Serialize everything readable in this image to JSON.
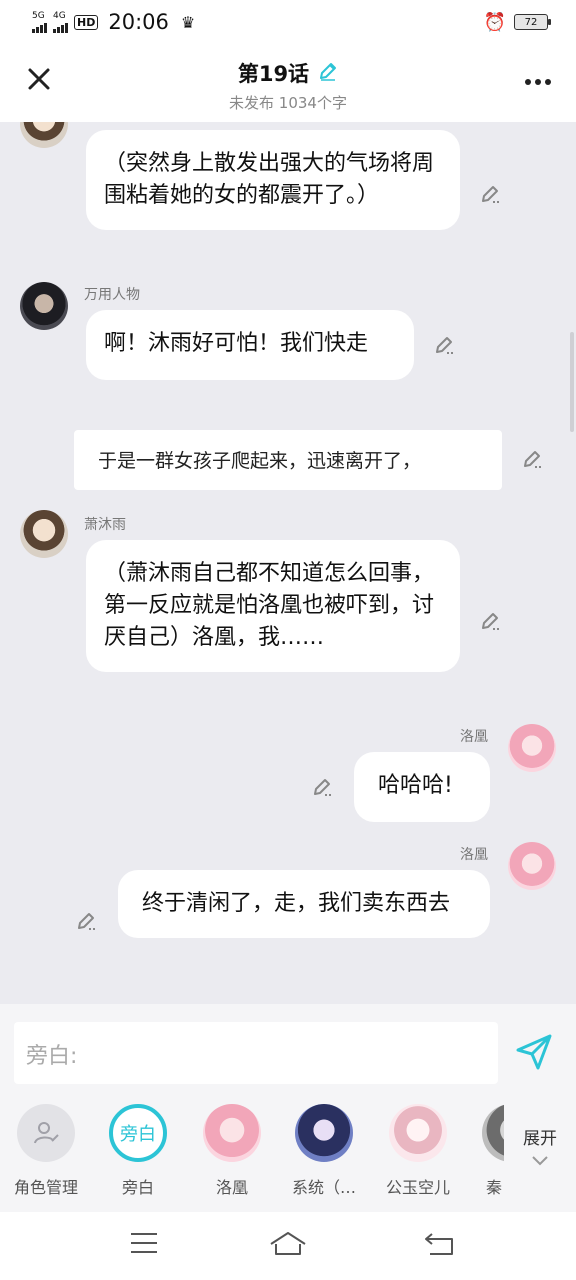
{
  "status_bar": {
    "network1": "5G",
    "network2": "4G",
    "hd": "HD",
    "time": "20:06",
    "battery": "72"
  },
  "header": {
    "title": "第19话",
    "subtitle": "未发布 1034个字"
  },
  "messages": [
    {
      "text": "（突然身上散发出强大的气场将周围粘着她的女的都震开了。）"
    },
    {
      "speaker": "万用人物",
      "text": "啊！沐雨好可怕！我们快走"
    },
    {
      "text": "于是一群女孩子爬起来，迅速离开了，"
    },
    {
      "speaker": "萧沐雨",
      "text": "（萧沐雨自己都不知道怎么回事，第一反应就是怕洛凰也被吓到，讨厌自己）洛凰，我……"
    },
    {
      "speaker": "洛凰",
      "text": "哈哈哈!"
    },
    {
      "speaker": "洛凰",
      "text": "终于清闲了，走，我们卖东西去"
    }
  ],
  "input": {
    "placeholder": "旁白:"
  },
  "characters": [
    {
      "label": "角色管理",
      "icon": "person-edit-icon"
    },
    {
      "label": "旁白",
      "avatar_text": "旁白"
    },
    {
      "label": "洛凰"
    },
    {
      "label": "系统（…"
    },
    {
      "label": "公玉空儿"
    },
    {
      "label": "秦"
    }
  ],
  "expand_label": "展开",
  "colors": {
    "accent": "#2cc4d6",
    "chat_bg": "#ebebf0"
  }
}
